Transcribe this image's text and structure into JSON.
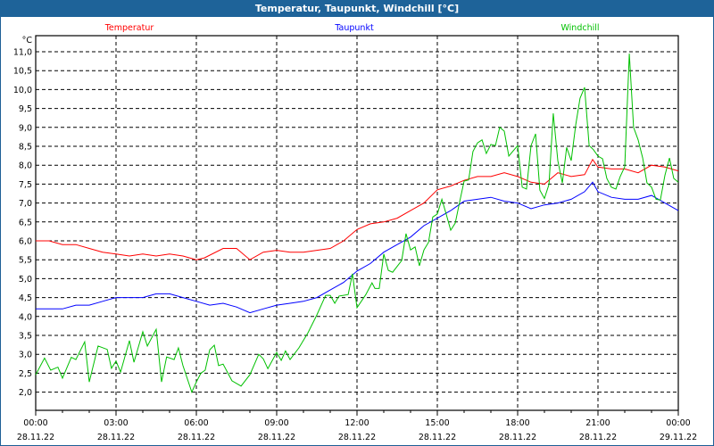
{
  "chart_data": {
    "type": "line",
    "title": "Temperatur, Taupunkt, Windchill [°C]",
    "ylabel": "°C",
    "xlabel": "",
    "ylim": [
      1.5,
      11.4
    ],
    "xlim_hours": [
      0,
      24
    ],
    "grid": true,
    "legend_placement": "top",
    "y_ticks": [
      "2,0",
      "2,5",
      "3,0",
      "3,5",
      "4,0",
      "4,5",
      "5,0",
      "5,5",
      "6,0",
      "6,5",
      "7,0",
      "7,5",
      "8,0",
      "8,5",
      "9,0",
      "9,5",
      "10,0",
      "10,5",
      "11,0"
    ],
    "x_ticks": [
      {
        "time": "00:00",
        "date": "28.11.22"
      },
      {
        "time": "03:00",
        "date": "28.11.22"
      },
      {
        "time": "06:00",
        "date": "28.11.22"
      },
      {
        "time": "09:00",
        "date": "28.11.22"
      },
      {
        "time": "12:00",
        "date": "28.11.22"
      },
      {
        "time": "15:00",
        "date": "28.11.22"
      },
      {
        "time": "18:00",
        "date": "28.11.22"
      },
      {
        "time": "21:00",
        "date": "28.11.22"
      },
      {
        "time": "00:00",
        "date": "29.11.22"
      }
    ],
    "series": [
      {
        "name": "Temperatur",
        "color": "#ff0000",
        "x_hours": [
          0,
          0.5,
          1,
          1.5,
          2,
          2.5,
          3,
          3.5,
          4,
          4.5,
          5,
          5.5,
          6,
          6.3,
          7,
          7.5,
          8,
          8.5,
          9,
          9.5,
          10,
          11,
          11.5,
          12,
          12.5,
          13,
          13.5,
          14,
          14.5,
          15,
          15.5,
          16,
          16.5,
          17,
          17.5,
          18,
          18.5,
          19,
          19.5,
          20,
          20.5,
          20.8,
          21,
          21.5,
          22,
          22.5,
          23,
          23.5,
          24
        ],
        "values": [
          6.0,
          6.0,
          5.9,
          5.9,
          5.8,
          5.7,
          5.65,
          5.6,
          5.65,
          5.6,
          5.65,
          5.6,
          5.5,
          5.55,
          5.8,
          5.8,
          5.5,
          5.7,
          5.75,
          5.7,
          5.7,
          5.8,
          6.0,
          6.3,
          6.45,
          6.5,
          6.6,
          6.8,
          7.0,
          7.35,
          7.45,
          7.6,
          7.7,
          7.7,
          7.8,
          7.7,
          7.55,
          7.5,
          7.8,
          7.7,
          7.75,
          8.15,
          7.95,
          7.9,
          7.9,
          7.8,
          8.0,
          7.95,
          7.85
        ]
      },
      {
        "name": "Taupunkt",
        "color": "#0000ff",
        "x_hours": [
          0,
          1,
          1.5,
          2,
          2.5,
          3,
          4,
          4.5,
          5,
          5.5,
          6,
          6.5,
          7,
          7.5,
          8,
          8.5,
          9,
          9.5,
          10,
          10.5,
          11,
          11.5,
          12,
          12.5,
          13,
          13.5,
          14,
          14.5,
          15,
          15.5,
          16,
          16.5,
          17,
          17.5,
          18,
          18.5,
          19,
          19.5,
          20,
          20.5,
          20.8,
          21,
          21.5,
          22,
          22.5,
          23,
          23.5,
          24
        ],
        "values": [
          4.2,
          4.2,
          4.3,
          4.3,
          4.4,
          4.5,
          4.5,
          4.6,
          4.6,
          4.5,
          4.4,
          4.3,
          4.35,
          4.25,
          4.1,
          4.2,
          4.3,
          4.35,
          4.4,
          4.5,
          4.7,
          4.9,
          5.2,
          5.4,
          5.7,
          5.9,
          6.1,
          6.4,
          6.6,
          6.8,
          7.05,
          7.1,
          7.15,
          7.05,
          7.0,
          6.85,
          6.95,
          7.0,
          7.1,
          7.3,
          7.55,
          7.3,
          7.15,
          7.1,
          7.1,
          7.2,
          7.0,
          6.8
        ]
      },
      {
        "name": "Windchill",
        "color": "#00c000",
        "x_hours": [
          0,
          0.33,
          0.56,
          0.83,
          1.0,
          1.33,
          1.5,
          1.83,
          2.0,
          2.33,
          2.67,
          2.83,
          3.0,
          3.17,
          3.5,
          3.67,
          4.0,
          4.17,
          4.5,
          4.7,
          4.89,
          5.17,
          5.33,
          5.5,
          5.83,
          6.0,
          6.17,
          6.33,
          6.5,
          6.67,
          6.83,
          7.0,
          7.33,
          7.67,
          8.0,
          8.33,
          8.5,
          8.67,
          9.0,
          9.17,
          9.33,
          9.5,
          9.83,
          10.17,
          10.5,
          10.83,
          11.0,
          11.17,
          11.33,
          11.67,
          11.83,
          12.0,
          12.33,
          12.56,
          12.67,
          12.83,
          13.0,
          13.17,
          13.33,
          13.67,
          13.83,
          14.0,
          14.17,
          14.33,
          14.5,
          14.67,
          14.83,
          15.0,
          15.17,
          15.33,
          15.5,
          15.67,
          15.83,
          16.0,
          16.17,
          16.33,
          16.5,
          16.67,
          16.83,
          17.0,
          17.17,
          17.33,
          17.5,
          17.67,
          18.0,
          18.17,
          18.33,
          18.5,
          18.67,
          18.83,
          19.0,
          19.17,
          19.33,
          19.5,
          19.67,
          19.83,
          20.0,
          20.17,
          20.33,
          20.5,
          20.67,
          20.83,
          21.0,
          21.17,
          21.33,
          21.5,
          21.67,
          21.83,
          22.0,
          22.17,
          22.33,
          22.5,
          22.67,
          22.83,
          23.0,
          23.17,
          23.33,
          23.5,
          23.67,
          23.83,
          24.0
        ],
        "values": [
          2.46,
          2.9,
          2.58,
          2.66,
          2.37,
          2.92,
          2.86,
          3.33,
          2.27,
          3.22,
          3.13,
          2.63,
          2.82,
          2.53,
          3.36,
          2.79,
          3.6,
          3.22,
          3.66,
          2.27,
          2.93,
          2.86,
          3.17,
          2.7,
          2.0,
          2.27,
          2.5,
          2.58,
          3.12,
          3.24,
          2.7,
          2.74,
          2.3,
          2.16,
          2.46,
          3.0,
          2.88,
          2.62,
          3.05,
          2.84,
          3.09,
          2.86,
          3.17,
          3.57,
          4.04,
          4.56,
          4.56,
          4.35,
          4.54,
          4.58,
          5.13,
          4.23,
          4.58,
          4.89,
          4.74,
          4.74,
          5.65,
          5.22,
          5.17,
          5.48,
          6.19,
          5.76,
          5.84,
          5.34,
          5.76,
          5.96,
          6.63,
          6.71,
          7.1,
          6.71,
          6.28,
          6.47,
          7.02,
          7.58,
          7.61,
          8.36,
          8.59,
          8.67,
          8.31,
          8.55,
          8.52,
          9.0,
          8.9,
          8.24,
          8.52,
          7.42,
          7.37,
          8.52,
          8.83,
          7.34,
          7.12,
          7.49,
          9.37,
          8.12,
          7.53,
          8.47,
          8.12,
          9.07,
          9.77,
          10.06,
          8.52,
          8.41,
          8.24,
          8.17,
          7.65,
          7.42,
          7.37,
          7.7,
          7.96,
          10.95,
          9.0,
          8.67,
          8.19,
          7.53,
          7.42,
          7.1,
          7.08,
          7.73,
          8.19,
          7.65,
          7.55
        ]
      }
    ]
  }
}
